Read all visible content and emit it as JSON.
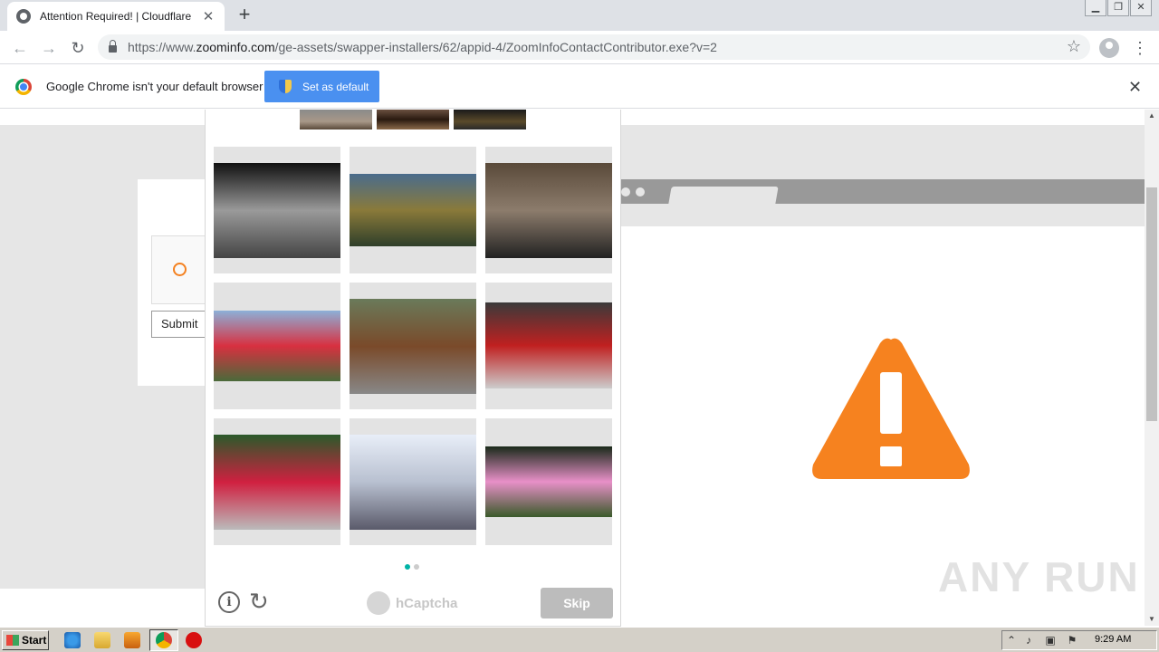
{
  "browser": {
    "tab_title": "Attention Required! | Cloudflare",
    "url_prefix": "https://www.",
    "url_host": "zoominfo.com",
    "url_path": "/ge-assets/swapper-installers/62/appid-4/ZoomInfoContactContributor.exe?v=2",
    "new_tab_label": "+",
    "tab_close_label": "✕"
  },
  "infobar": {
    "message": "Google Chrome isn't your default browser",
    "set_default_label": "Set as default",
    "close_label": "✕"
  },
  "page": {
    "submit_label": "Submit",
    "warning_color": "#f6821f"
  },
  "captcha": {
    "example_images": [
      "rail-track-1",
      "rail-track-2",
      "rail-track-3"
    ],
    "tiles": [
      {
        "id": "sports-car",
        "colors": [
          "#111",
          "#9a9a9a",
          "#444"
        ]
      },
      {
        "id": "double-decker-bus",
        "colors": [
          "#4a6c8c",
          "#8a7a3a",
          "#2f3f2a"
        ]
      },
      {
        "id": "rubble-bike",
        "colors": [
          "#5a4a3a",
          "#8c7c6c",
          "#222"
        ]
      },
      {
        "id": "red-bus-station",
        "colors": [
          "#8cb0d8",
          "#d83040",
          "#4a6a3a"
        ]
      },
      {
        "id": "train-platform",
        "colors": [
          "#6a7a5a",
          "#7a4a2a",
          "#888"
        ]
      },
      {
        "id": "fire-engine",
        "colors": [
          "#3a3a3a",
          "#c02020",
          "#ccc"
        ]
      },
      {
        "id": "red-coach",
        "colors": [
          "#2a5a2a",
          "#d02040",
          "#bbb"
        ]
      },
      {
        "id": "train-side",
        "colors": [
          "#e8eef8",
          "#b8c0d0",
          "#5a5a6a"
        ]
      },
      {
        "id": "pink-tour-bus",
        "colors": [
          "#1a2a1a",
          "#e890c8",
          "#3a5a2a"
        ]
      }
    ],
    "page_dots": [
      true,
      false
    ],
    "brand": "hCaptcha",
    "skip_label": "Skip",
    "accent": "#00b3a6"
  },
  "watermark": "ANY RUN",
  "taskbar": {
    "start_label": "Start",
    "clock": "9:29 AM"
  }
}
